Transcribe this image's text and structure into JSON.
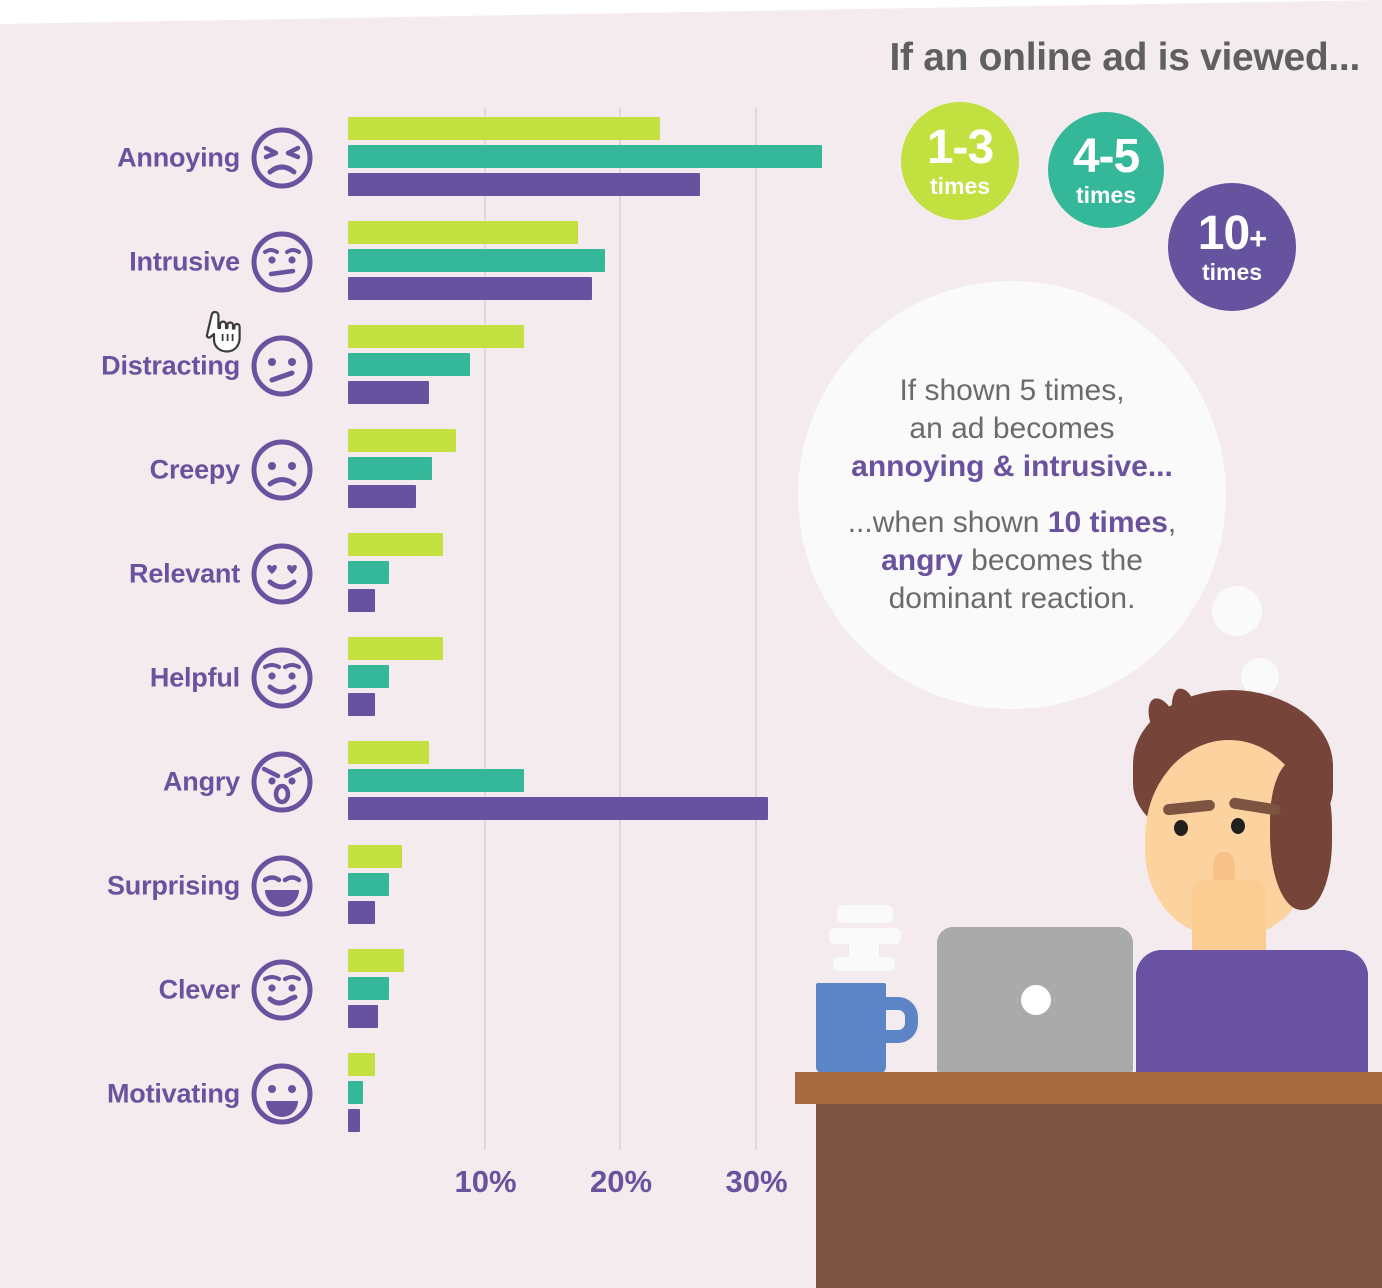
{
  "header": {
    "headline": "If an online ad is viewed..."
  },
  "colors": {
    "background": "#f4ebee",
    "series_1_3": "#c2e03f",
    "series_4_5": "#35b89a",
    "series_10plus": "#66539f",
    "label_text": "#6a529f",
    "headline_text": "#5f5f5f",
    "bubble_fill": "#fbfafa",
    "desk_top": "#a5683f",
    "desk_front": "#7d5342"
  },
  "frequency_circles": [
    {
      "num": "1-3",
      "plus": "",
      "times": "times",
      "color": "#c2e03f"
    },
    {
      "num": "4-5",
      "plus": "",
      "times": "times",
      "color": "#35b89a"
    },
    {
      "num": "10",
      "plus": "+",
      "times": "times",
      "color": "#66539f"
    }
  ],
  "bubble": {
    "line1": "If shown 5 times,",
    "line2": "an ad becomes",
    "line3_highlight": "annoying & intrusive...",
    "line4_pre": "...when shown ",
    "line4_bold": "10 times",
    "line4_post": ",",
    "line5_highlight": "angry",
    "line5_post": " becomes the",
    "line6": "dominant reaction."
  },
  "legend": [
    {
      "name": "1-3 times",
      "color": "#c2e03f"
    },
    {
      "name": "4-5 times",
      "color": "#35b89a"
    },
    {
      "name": "10+ times",
      "color": "#66539f"
    }
  ],
  "axis": {
    "ticks": [
      "10%",
      "20%",
      "30%"
    ],
    "tick_values": [
      10,
      20,
      30
    ]
  },
  "icons": {
    "annoying": "face-annoyed-icon",
    "intrusive": "face-worried-icon",
    "distracting": "face-confused-icon",
    "creepy": "face-frowning-icon",
    "relevant": "face-heart-eyes-icon",
    "helpful": "face-smiling-icon",
    "angry": "face-angry-icon",
    "surprising": "face-laughing-icon",
    "clever": "face-smirk-icon",
    "motivating": "face-grin-icon",
    "cursor": "pointer-cursor-icon"
  },
  "chart_data": {
    "type": "bar",
    "orientation": "horizontal",
    "title": "If an online ad is viewed...",
    "xlabel": "",
    "ylabel": "",
    "xlim": [
      0,
      37
    ],
    "grid": true,
    "gridlines": [
      10,
      20,
      30
    ],
    "legend_position": "top-right",
    "categories": [
      "Annoying",
      "Intrusive",
      "Distracting",
      "Creepy",
      "Relevant",
      "Helpful",
      "Angry",
      "Surprising",
      "Clever",
      "Motivating"
    ],
    "series": [
      {
        "name": "1-3 times",
        "color": "#c2e03f",
        "values": [
          23.0,
          17.0,
          13.0,
          8.0,
          7.0,
          7.0,
          6.0,
          4.0,
          4.1,
          2.0
        ]
      },
      {
        "name": "4-5 times",
        "color": "#35b89a",
        "values": [
          35.0,
          19.0,
          9.0,
          6.2,
          3.0,
          3.0,
          13.0,
          3.0,
          3.0,
          1.1
        ]
      },
      {
        "name": "10+ times",
        "color": "#66539f",
        "values": [
          26.0,
          18.0,
          6.0,
          5.0,
          2.0,
          2.0,
          31.0,
          2.0,
          2.2,
          0.9
        ]
      }
    ]
  }
}
